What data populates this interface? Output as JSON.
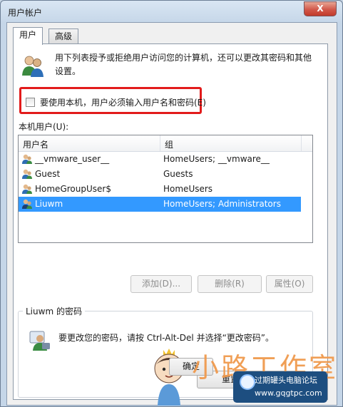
{
  "window": {
    "title": "用户帐户",
    "close_glyph": "X"
  },
  "tabs": [
    {
      "label": "用户",
      "active": true
    },
    {
      "label": "高级",
      "active": false
    }
  ],
  "intro_text": "用下列表授予或拒绝用户访问您的计算机，还可以更改其密码和其他设置。",
  "require_login": {
    "label": "要使用本机，用户必须输入用户名和密码(E)",
    "checked": false
  },
  "users_section_label": "本机用户(U):",
  "users_table": {
    "columns": [
      "用户名",
      "组"
    ],
    "rows": [
      {
        "name": "__vmware_user__",
        "group": "HomeUsers; __vmware__",
        "selected": false
      },
      {
        "name": "Guest",
        "group": "Guests",
        "selected": false
      },
      {
        "name": "HomeGroupUser$",
        "group": "HomeUsers",
        "selected": false
      },
      {
        "name": "Liuwm",
        "group": "HomeUsers; Administrators",
        "selected": true
      }
    ]
  },
  "actions": {
    "add": "添加(D)...",
    "remove": "删除(R)",
    "properties": "属性(O)"
  },
  "password_group": {
    "title": "Liuwm 的密码",
    "text": "要更改您的密码，请按 Ctrl-Alt-Del 并选择“更改密码”。",
    "reset_button": "重置密码(P)..."
  },
  "footer": {
    "ok": "确定"
  },
  "watermark": {
    "brand": "小路工作室",
    "forum_name": "过期罐头电脑论坛",
    "forum_url": "www.gqgtpc.com"
  },
  "icons": {
    "users": "users-icon",
    "user_row": "user-icon",
    "password": "user-password-icon"
  },
  "colors": {
    "selection": "#3399ff",
    "highlight_border": "#e21b1b",
    "brand_orange": "#f09a4e"
  }
}
